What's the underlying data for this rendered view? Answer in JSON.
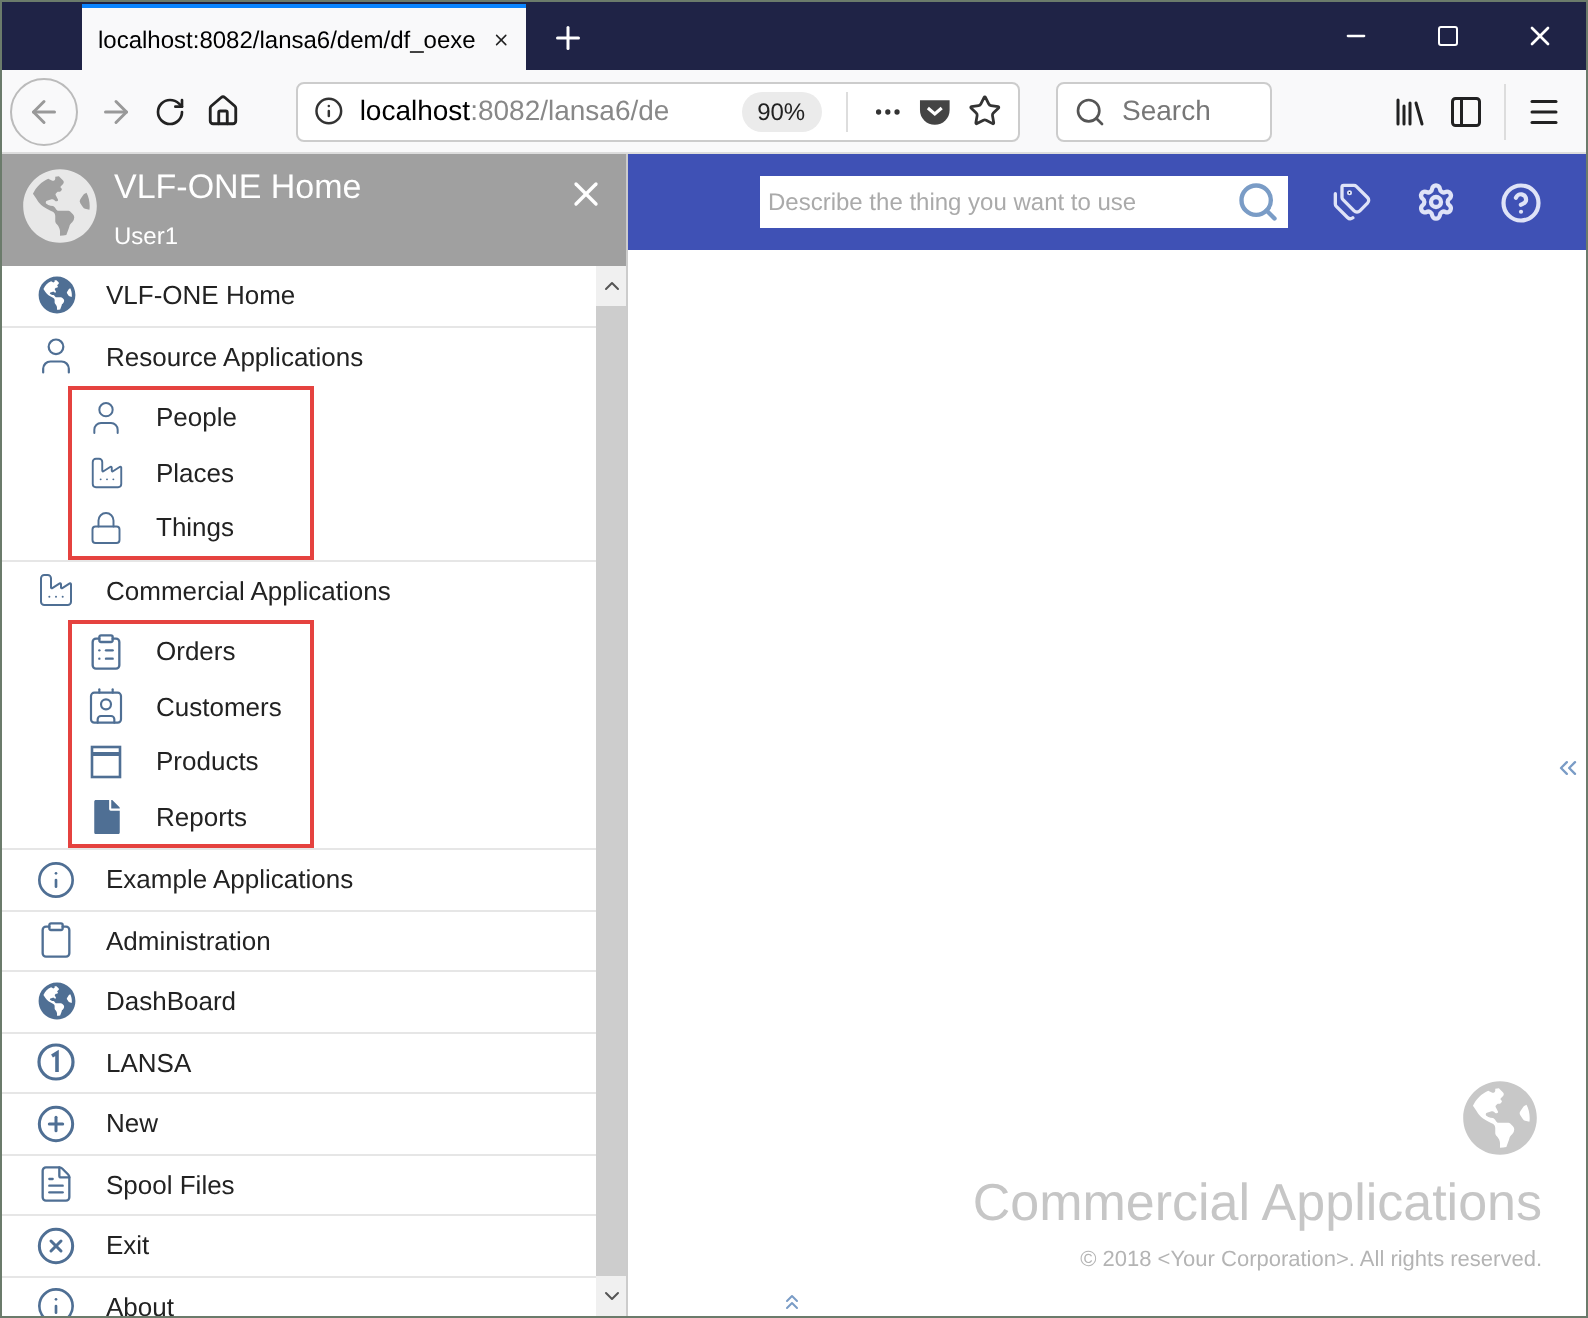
{
  "browser": {
    "tab_title": "localhost:8082/lansa6/dem/df_oexe",
    "url_host": "localhost",
    "url_rest": ":8082/lansa6/de",
    "zoom": "90%",
    "search": {
      "placeholder": "Search"
    }
  },
  "sidebar": {
    "title": "VLF-ONE Home",
    "user": "User1",
    "items": [
      {
        "label": "VLF-ONE Home"
      },
      {
        "label": "Resource Applications",
        "boxed": true,
        "children": [
          {
            "label": "People"
          },
          {
            "label": "Places"
          },
          {
            "label": "Things"
          }
        ]
      },
      {
        "label": "Commercial Applications",
        "boxed": true,
        "children": [
          {
            "label": "Orders"
          },
          {
            "label": "Customers"
          },
          {
            "label": "Products"
          },
          {
            "label": "Reports"
          }
        ]
      },
      {
        "label": "Example Applications"
      },
      {
        "label": "Administration"
      },
      {
        "label": "DashBoard"
      },
      {
        "label": "LANSA"
      },
      {
        "label": "New"
      },
      {
        "label": "Spool Files"
      },
      {
        "label": "Exit"
      },
      {
        "label": "About"
      }
    ]
  },
  "header": {
    "search": {
      "placeholder": "Describe the thing you want to use"
    }
  },
  "main": {
    "title": "Commercial Applications",
    "copyright": "© 2018 <Your Corporation>. All rights reserved."
  }
}
